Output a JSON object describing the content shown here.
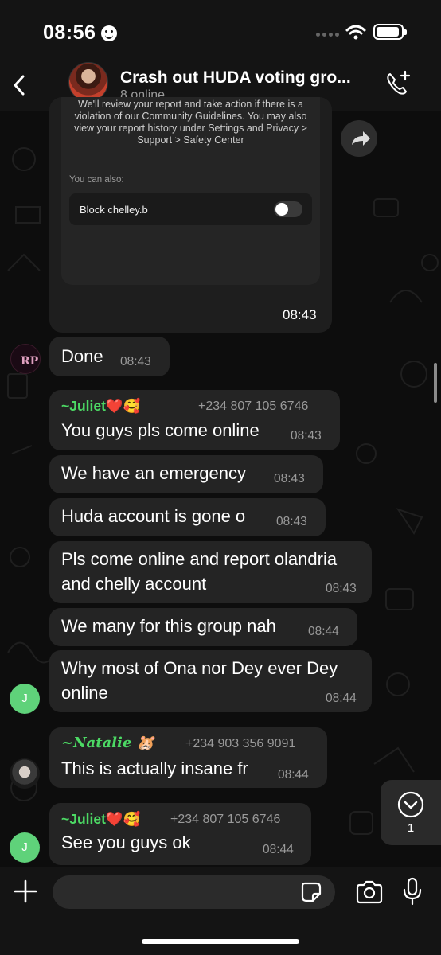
{
  "status_bar": {
    "time": "08:56"
  },
  "header": {
    "title": "Crash out HUDA voting gro...",
    "subtitle": "8 online"
  },
  "report_card": {
    "text": "We'll review your report and take action if there is a violation of our Community Guidelines. You may also view your report history under Settings and Privacy > Support > Safety Center",
    "also_label": "You can also:",
    "block_label": "Block chelley.b",
    "time": "08:43"
  },
  "messages": [
    {
      "text": "Done",
      "time": "08:43"
    },
    {
      "sender": "~Juliet❤️🥰",
      "phone": "+234 807 105 6746",
      "text": "You guys pls come online",
      "time": "08:43"
    },
    {
      "text": "We have an emergency",
      "time": "08:43"
    },
    {
      "text": "Huda account is gone o",
      "time": "08:43"
    },
    {
      "text_line1": "Pls come online and report olandria",
      "text_line2": "and chelly account",
      "time": "08:43"
    },
    {
      "text": "We many for this group nah",
      "time": "08:44"
    },
    {
      "text_line1": "Why most of Ona nor Dey ever Dey",
      "text_line2": "online",
      "time": "08:44"
    },
    {
      "sender": "~Natalie 🐹",
      "phone": "+234 903 356 9091",
      "text": "This is actually insane fr",
      "time": "08:44"
    },
    {
      "sender": "~Juliet❤️🥰",
      "phone": "+234 807 105 6746",
      "text": "See you guys ok",
      "time": "08:44"
    }
  ],
  "avatars": {
    "juliet_initial": "J"
  },
  "scroll_button": {
    "count": "1"
  },
  "composer": {
    "placeholder": ""
  },
  "colors": {
    "sender_green": "#4cd964",
    "bubble": "#242424",
    "background": "#0d0d0d"
  },
  "icons": [
    "back-icon",
    "call-add-icon",
    "share-icon",
    "chevron-down-icon",
    "plus-icon",
    "sticker-icon",
    "camera-icon",
    "mic-icon",
    "wifi-icon",
    "battery-icon"
  ]
}
